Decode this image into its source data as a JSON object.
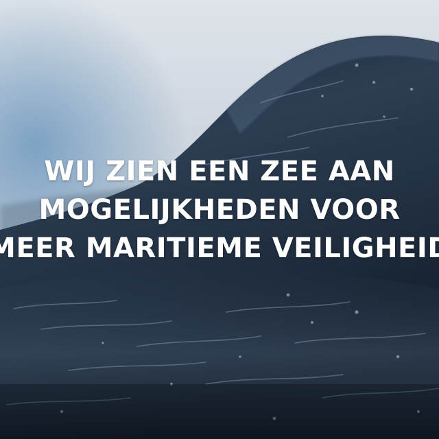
{
  "headline": {
    "lines": [
      "WIJ ZIEN EEN ZEE AAN",
      "MOGELIJKHEDEN VOOR",
      "MEER MARITIEME VEILIGHEID"
    ]
  },
  "background": {
    "subject": "stormy-sea-wave",
    "colors": {
      "sky_top": "#d9dfe6",
      "sky_bottom": "#aebdca",
      "sky_blue": "#7fa3c2",
      "wave_dark": "#14202f",
      "wave_mid": "#2c3d52",
      "wave_light": "#5d7287",
      "foam": "#c9d4de"
    }
  }
}
